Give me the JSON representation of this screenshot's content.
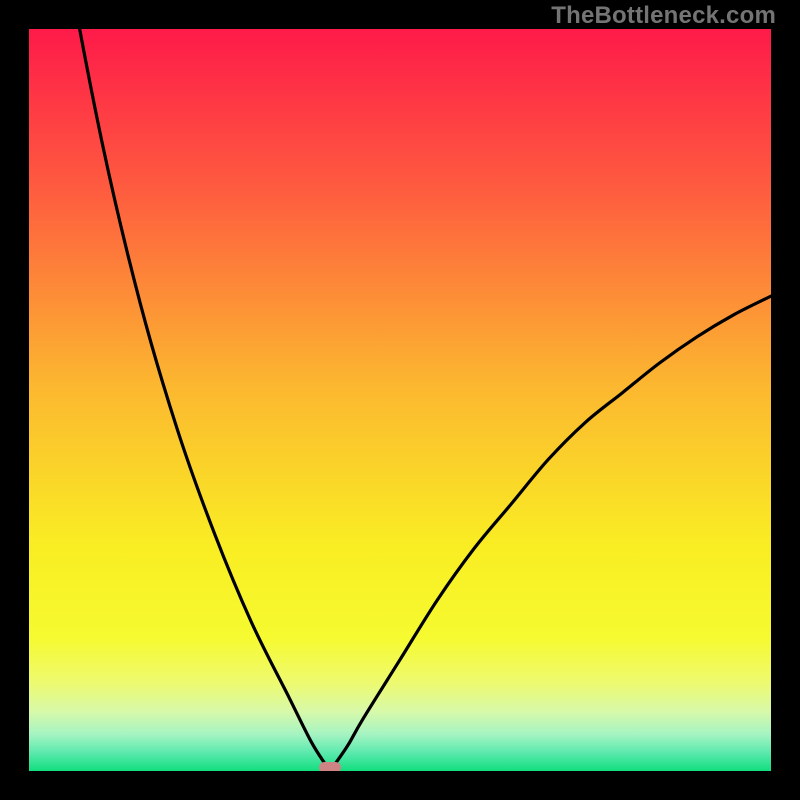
{
  "watermark": {
    "text": "TheBottleneck.com"
  },
  "chart_data": {
    "type": "line",
    "title": "",
    "xlabel": "",
    "ylabel": "",
    "xlim": [
      0,
      100
    ],
    "ylim": [
      0,
      100
    ],
    "grid": false,
    "legend": false,
    "optimum_x": 40.5,
    "series": [
      {
        "name": "bottleneck-curve",
        "x": [
          0,
          5,
          10,
          15,
          20,
          25,
          30,
          35,
          38,
          40,
          40.5,
          41,
          43,
          45,
          50,
          55,
          60,
          65,
          70,
          75,
          80,
          85,
          90,
          95,
          100
        ],
        "values": [
          140,
          110,
          84,
          63,
          46,
          32,
          20,
          10,
          4,
          0.8,
          0,
          0.6,
          3.5,
          7,
          15,
          23,
          30,
          36,
          42,
          47,
          51,
          55,
          58.5,
          61.5,
          64
        ]
      }
    ],
    "marker": {
      "x": 40.5,
      "y": 0,
      "color": "#CE8484"
    },
    "gradient_stops": [
      {
        "pct": 0,
        "color": "#FE1A49"
      },
      {
        "pct": 22,
        "color": "#FE5D3F"
      },
      {
        "pct": 48,
        "color": "#FCB730"
      },
      {
        "pct": 70,
        "color": "#F9EE23"
      },
      {
        "pct": 82,
        "color": "#F6FA30"
      },
      {
        "pct": 88,
        "color": "#EEFA6E"
      },
      {
        "pct": 92,
        "color": "#D7F9A9"
      },
      {
        "pct": 95,
        "color": "#A6F4C2"
      },
      {
        "pct": 97.5,
        "color": "#5DE9AE"
      },
      {
        "pct": 100,
        "color": "#12DE7E"
      }
    ]
  }
}
